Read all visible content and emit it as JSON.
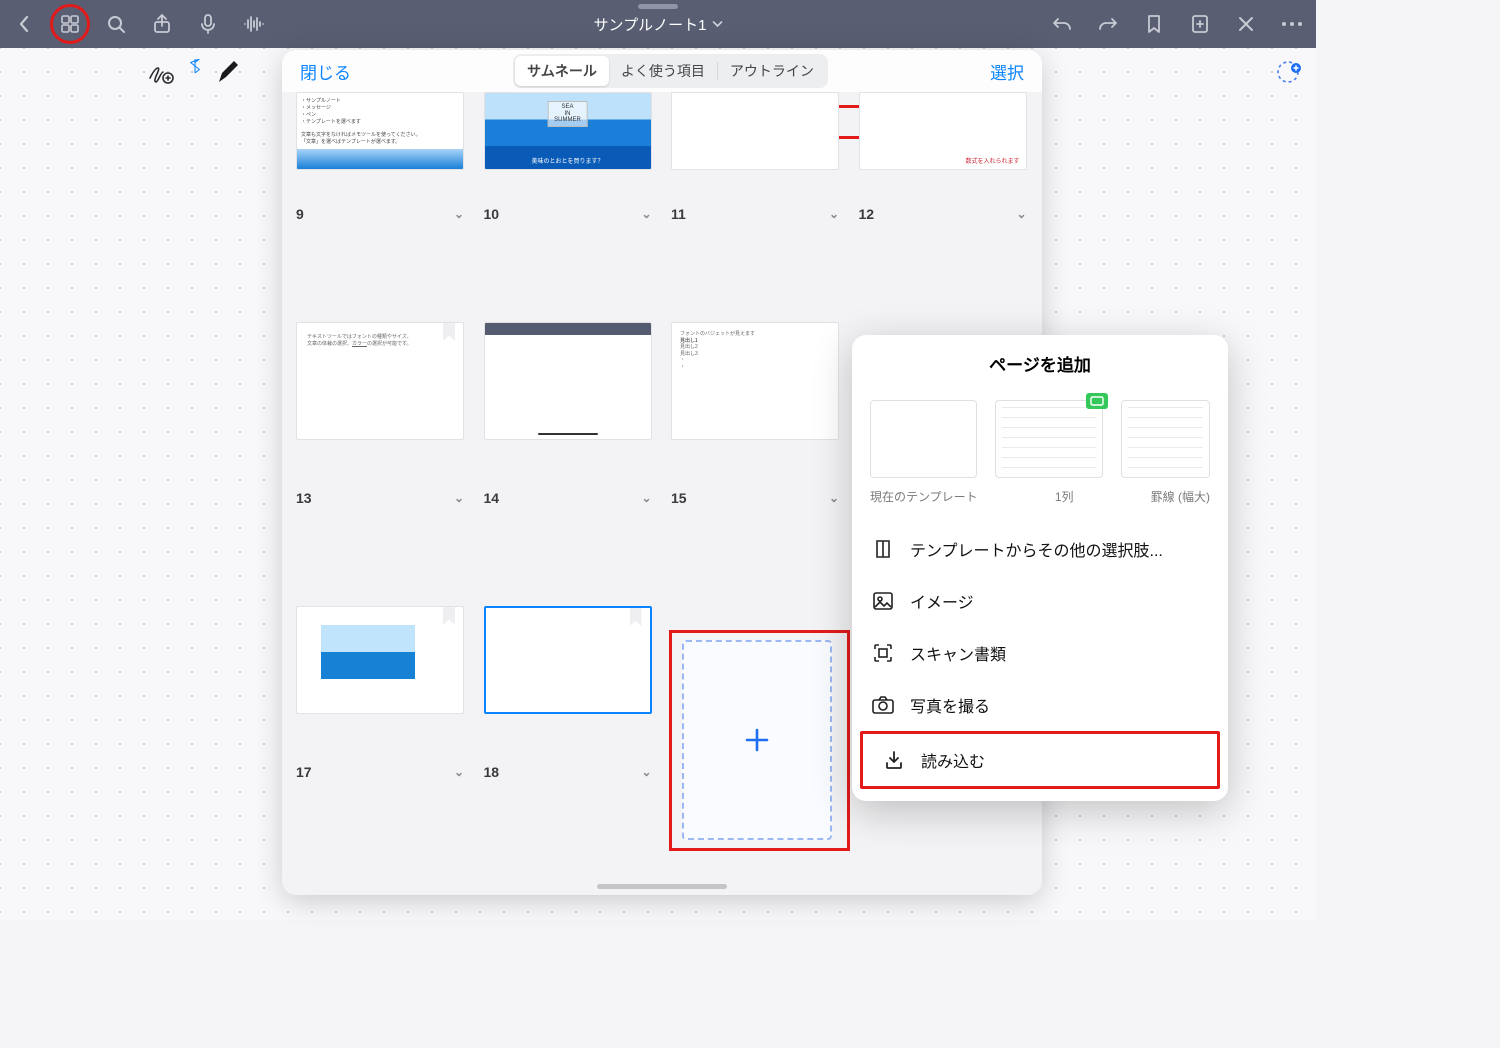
{
  "topbar": {
    "title": "サンプルノート1"
  },
  "panel": {
    "close": "閉じる",
    "select": "選択",
    "tabs": {
      "thumbnail": "サムネール",
      "favorites": "よく使う項目",
      "outline": "アウトライン"
    },
    "pages": [
      "9",
      "10",
      "11",
      "12",
      "13",
      "14",
      "15",
      "17",
      "18"
    ],
    "thumb_sea_lines": [
      "SEA",
      "IN",
      "SUMMER"
    ],
    "thumb_sea_caption": "美味のとおとを買ります？"
  },
  "popover": {
    "title": "ページを追加",
    "template_labels": {
      "current": "現在のテンプレート",
      "one_col": "1列",
      "ruled": "罫線 (幅大)"
    },
    "menu": {
      "templates": "テンプレートからその他の選択肢...",
      "image": "イメージ",
      "scan": "スキャン書類",
      "photo": "写真を撮る",
      "import": "読み込む"
    }
  }
}
